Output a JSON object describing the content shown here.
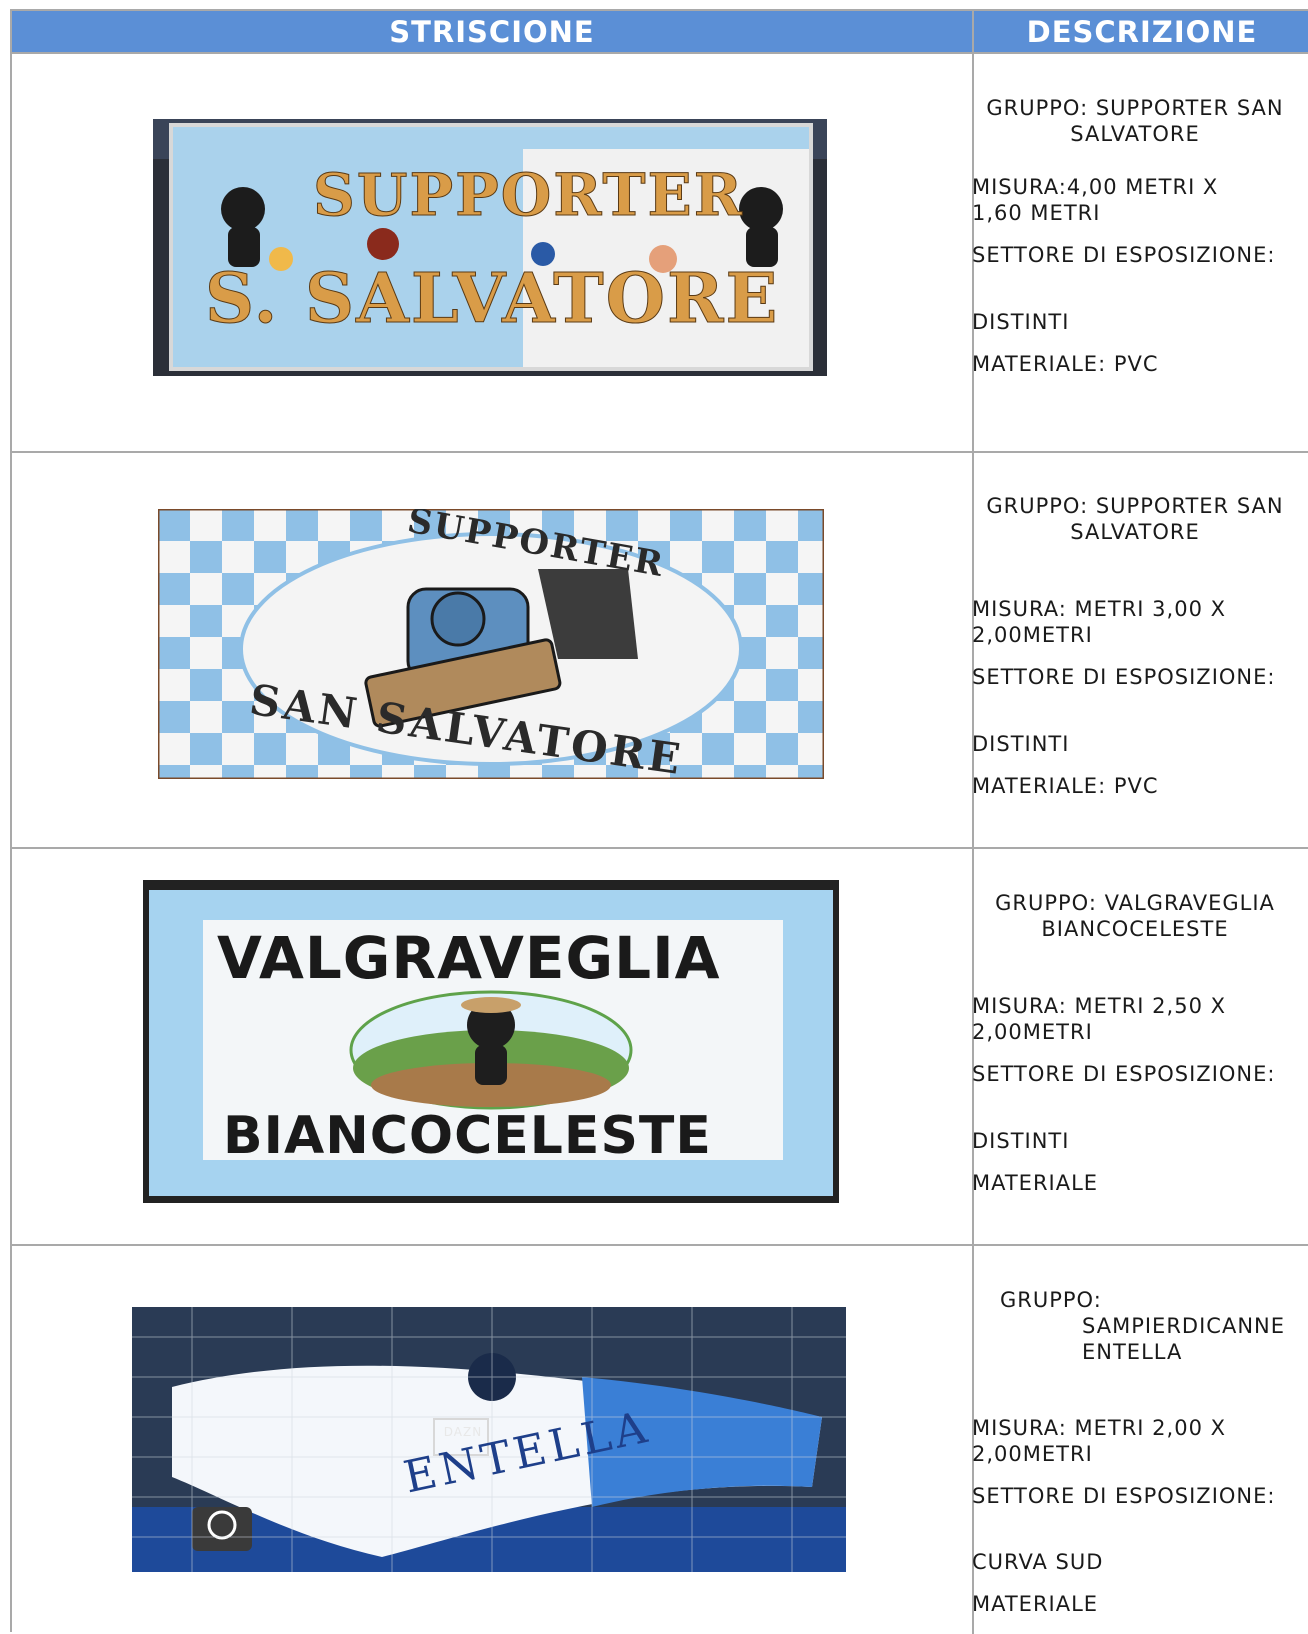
{
  "header": {
    "col1": "STRISCIONE",
    "col2": "DESCRIZIONE"
  },
  "rows": [
    {
      "banner_text": [
        "SUPPORTER",
        "S. SALVATORE"
      ],
      "gruppo": [
        "GRUPPO: SUPPORTER SAN",
        "SALVATORE"
      ],
      "misura": [
        "MISURA:4,00   METRI    X",
        "1,60 METRI"
      ],
      "settore_label": "SETTORE DI ESPOSIZIONE:",
      "settore": "DISTINTI",
      "materiale": "MATERIALE: PVC"
    },
    {
      "banner_text": [
        "SUPPORTER",
        "SAN SALVATORE"
      ],
      "gruppo": [
        "GRUPPO: SUPPORTER SAN",
        "SALVATORE"
      ],
      "misura": [
        "MISURA:  METRI 3,00   X",
        "2,00METRI"
      ],
      "settore_label": "SETTORE DI ESPOSIZIONE:",
      "settore": "DISTINTI",
      "materiale": "MATERIALE: PVC"
    },
    {
      "banner_text": [
        "VALGRAVEGLIA",
        "BIANCOCELESTE"
      ],
      "gruppo": [
        "GRUPPO: VALGRAVEGLIA",
        "BIANCOCELESTE"
      ],
      "misura": [
        "MISURA:  METRI 2,50   X",
        "2,00METRI"
      ],
      "settore_label": "SETTORE DI ESPOSIZIONE:",
      "settore": "DISTINTI",
      "materiale": "MATERIALE"
    },
    {
      "banner_text": [
        "ENTELLA",
        "DAZN"
      ],
      "gruppo": [
        "GRUPPO:",
        "SAMPIERDICANNE",
        "ENTELLA"
      ],
      "misura": [
        "MISURA:  METRI 2,00   X",
        "2,00METRI"
      ],
      "settore_label": "SETTORE DI ESPOSIZIONE:",
      "settore": "CURVA SUD",
      "materiale": "MATERIALE"
    }
  ],
  "colors": {
    "header_blue": "#5b8fd6",
    "sky_blue": "#a9d4ef",
    "grid_gray": "#a9a9a9"
  }
}
